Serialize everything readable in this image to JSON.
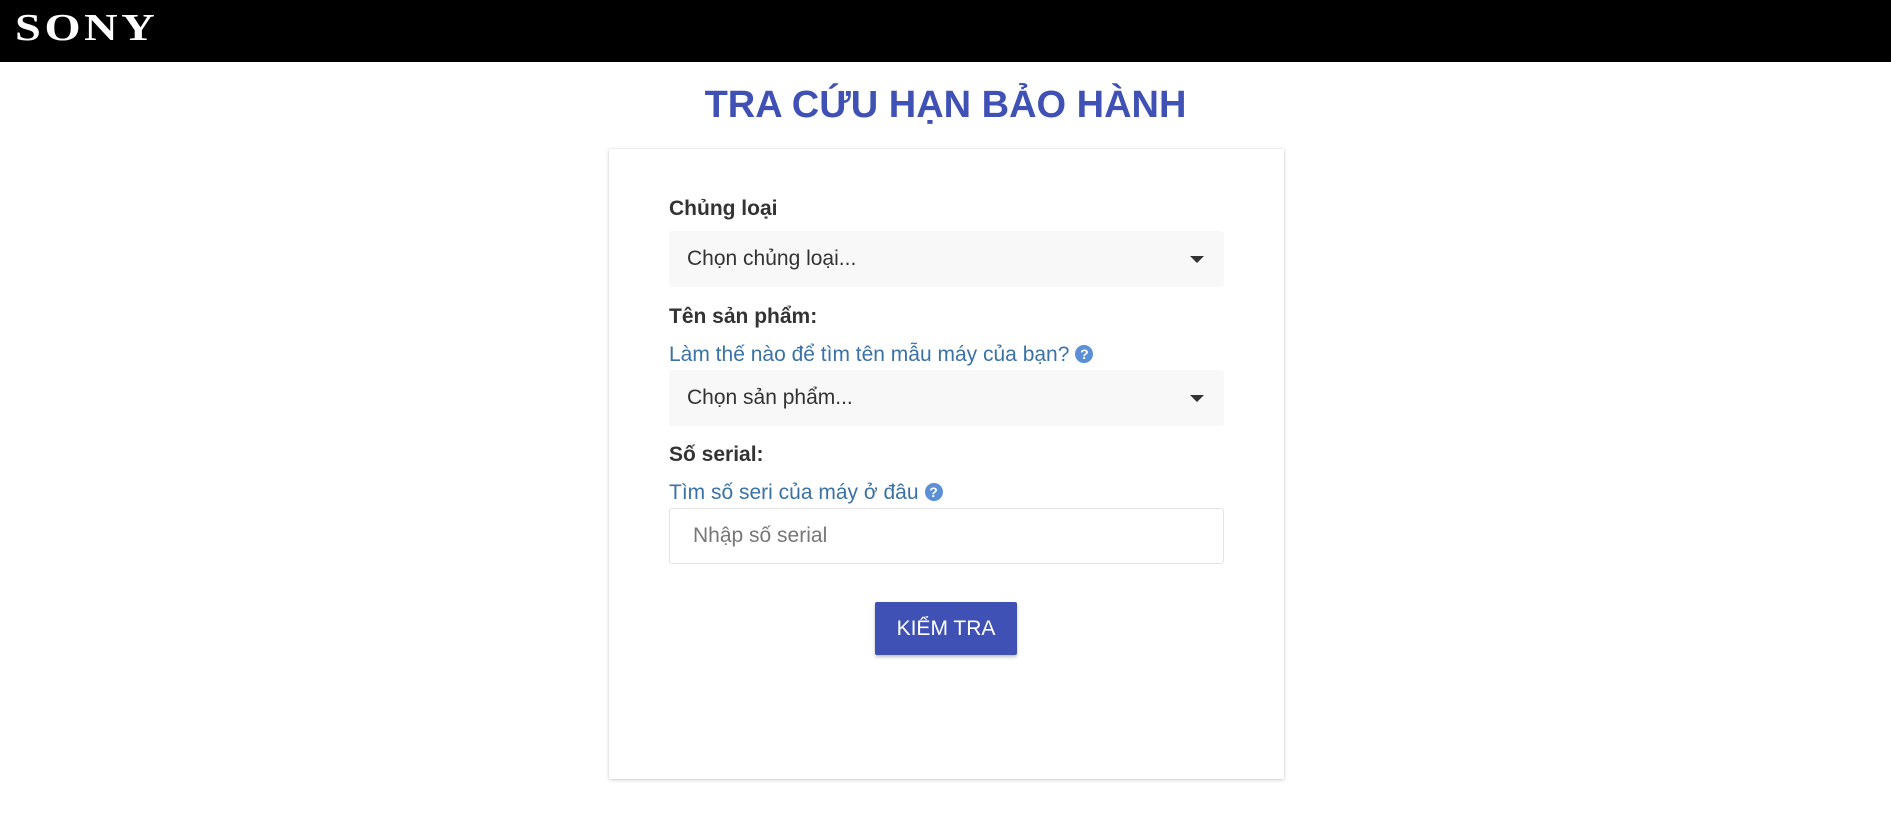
{
  "header": {
    "logo_text": "SONY"
  },
  "page": {
    "title": "TRA CỨU HẠN BẢO HÀNH"
  },
  "form": {
    "category": {
      "label": "Chủng loại",
      "selected": "Chọn chủng loại..."
    },
    "product": {
      "label": "Tên sản phẩm:",
      "help_text": "Làm thế nào để tìm tên mẫu máy của bạn?",
      "help_icon": "question-circle-icon",
      "selected": "Chọn sản phẩm..."
    },
    "serial": {
      "label": "Số serial:",
      "help_text": "Tìm số seri của máy ở đâu",
      "help_icon": "question-circle-icon",
      "placeholder": "Nhập số serial",
      "value": ""
    },
    "submit_label": "KIỂM TRA"
  },
  "colors": {
    "accent": "#3f51b5",
    "link": "#3a72a8",
    "header_bg": "#000000"
  }
}
